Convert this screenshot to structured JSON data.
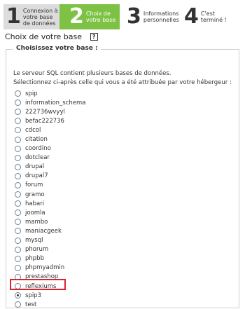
{
  "steps": [
    {
      "number": "1",
      "label": "Connexion à votre base de données"
    },
    {
      "number": "2",
      "label": "Choix de votre base"
    },
    {
      "number": "3",
      "label": "Informations personnelles"
    },
    {
      "number": "4",
      "label": "C'est terminé !"
    }
  ],
  "page_title": "Choix de votre base",
  "help_icon": "?",
  "legend": "Choisissez votre base :",
  "intro_line1": "Le serveur SQL contient plusieurs bases de données.",
  "intro_line2": "Sélectionnez ci-après celle qui vous a été attribuée par votre hébergeur :",
  "databases": [
    {
      "name": "spip",
      "checked": false
    },
    {
      "name": "information_schema",
      "checked": false
    },
    {
      "name": "222736wvyyl",
      "checked": false
    },
    {
      "name": "befac222736",
      "checked": false
    },
    {
      "name": "cdcol",
      "checked": false
    },
    {
      "name": "citation",
      "checked": false
    },
    {
      "name": "coordino",
      "checked": false
    },
    {
      "name": "dotclear",
      "checked": false
    },
    {
      "name": "drupal",
      "checked": false
    },
    {
      "name": "drupal7",
      "checked": false
    },
    {
      "name": "forum",
      "checked": false
    },
    {
      "name": "gramo",
      "checked": false
    },
    {
      "name": "habari",
      "checked": false
    },
    {
      "name": "joomla",
      "checked": false
    },
    {
      "name": "mambo",
      "checked": false
    },
    {
      "name": "maniacgeek",
      "checked": false
    },
    {
      "name": "mysql",
      "checked": false
    },
    {
      "name": "phorum",
      "checked": false
    },
    {
      "name": "phpbb",
      "checked": false
    },
    {
      "name": "phpmyadmin",
      "checked": false
    },
    {
      "name": "prestashop",
      "checked": false
    },
    {
      "name": "reflexiums",
      "checked": false
    },
    {
      "name": "spip3",
      "checked": true
    },
    {
      "name": "test",
      "checked": false
    }
  ],
  "colors": {
    "active_step": "#7ec245",
    "highlight": "#d9232d"
  }
}
